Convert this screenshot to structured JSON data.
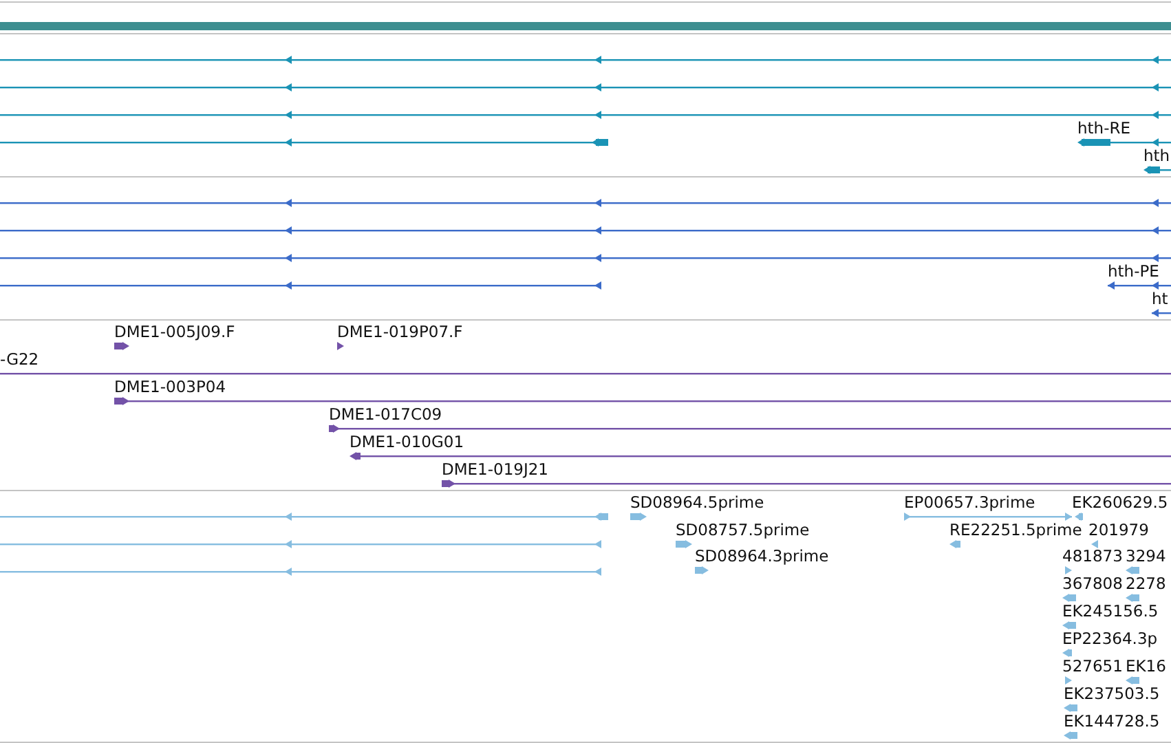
{
  "tracks": [
    {
      "color": "#1a93b5",
      "labels": [
        "hth-RE",
        "hth"
      ]
    },
    {
      "color": "#3b6bc9",
      "labels": [
        "hth-PE",
        "ht"
      ]
    },
    {
      "color": "#7352a8",
      "labels": [
        "DME1-005J09.F",
        "DME1-019P07.F",
        "-G22",
        "DME1-003P04",
        "DME1-017C09",
        "DME1-010G01",
        "DME1-019J21"
      ]
    },
    {
      "color": "#86bde0",
      "labels": [
        "SD08964.5prime",
        "SD08757.5prime",
        "SD08964.3prime",
        "EP00657.3prime",
        "EK260629.5",
        "RE22251.5prime",
        "201979",
        "481873",
        "3294",
        "367808",
        "2278",
        "EK245156.5",
        "EP22364.3p",
        "527651",
        "EK16",
        "EK237503.5",
        "EK144728.5"
      ]
    }
  ]
}
